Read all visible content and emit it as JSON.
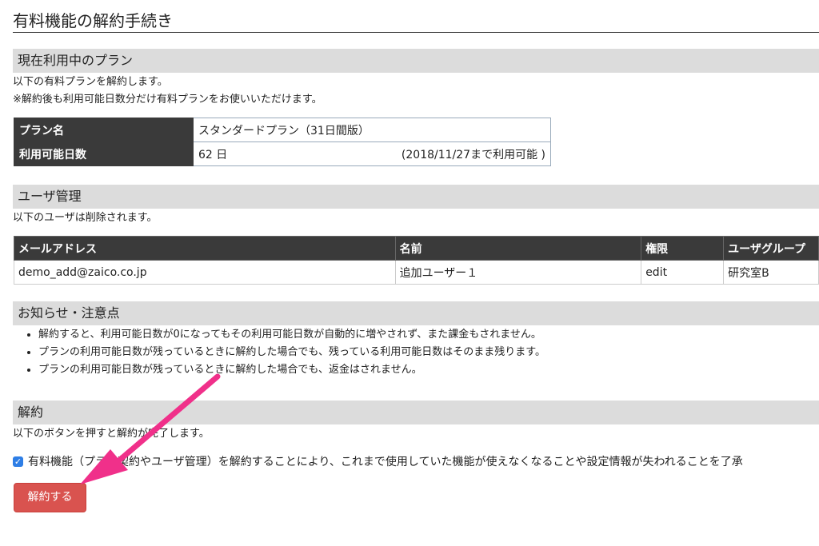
{
  "page_title": "有料機能の解約手続き",
  "current_plan": {
    "heading": "現在利用中のプラン",
    "lines": [
      "以下の有料プランを解約します。",
      "※解約後も利用可能日数分だけ有料プランをお使いいただけます。"
    ],
    "rows": [
      {
        "label": "プラン名",
        "value": "スタンダードプラン（31日間版）"
      },
      {
        "label": "利用可能日数",
        "value": "62 日",
        "note": "(2018/11/27まで利用可能 )"
      }
    ]
  },
  "user_mgmt": {
    "heading": "ユーザ管理",
    "line": "以下のユーザは削除されます。",
    "columns": [
      "メールアドレス",
      "名前",
      "権限",
      "ユーザグループ"
    ],
    "rows": [
      [
        "demo_add@zaico.co.jp",
        "追加ユーザー１",
        "edit",
        "研究室B"
      ]
    ]
  },
  "notice": {
    "heading": "お知らせ・注意点",
    "items": [
      "解約すると、利用可能日数が0になってもその利用可能日数が自動的に増やされず、また課金もされません。",
      "プランの利用可能日数が残っているときに解約した場合でも、残っている利用可能日数はそのまま残ります。",
      "プランの利用可能日数が残っているときに解約した場合でも、返金はされません。"
    ]
  },
  "cancel": {
    "heading": "解約",
    "line": "以下のボタンを押すと解約が完了します。",
    "confirm_checked": true,
    "confirm_text": "有料機能（プラン契約やユーザ管理）を解約することにより、これまで使用していた機能が使えなくなることや設定情報が失われることを了承",
    "button_label": "解約する"
  },
  "colors": {
    "header_dark": "#3a3a3a",
    "section_gray": "#dcdcdc",
    "button_red": "#d9534f",
    "arrow_pink": "#f0308a",
    "checkbox_blue": "#2e7ee6"
  }
}
